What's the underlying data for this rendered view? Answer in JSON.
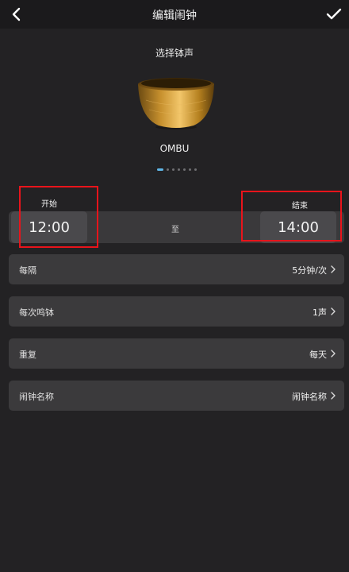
{
  "header": {
    "title": "编辑闹钟",
    "back_icon": "chevron-left-icon",
    "confirm_icon": "checkmark-icon"
  },
  "sound_picker": {
    "title": "选择钵声",
    "selected_name": "OMBU",
    "page_count": 7,
    "active_page": 1
  },
  "time_range": {
    "start_label": "开始",
    "start_time": "12:00",
    "separator": "至",
    "end_label": "结束",
    "end_time": "14:00"
  },
  "settings": [
    {
      "label": "每隔",
      "value": "5分钟/次"
    },
    {
      "label": "每次鸣钵",
      "value": "1声"
    },
    {
      "label": "重复",
      "value": "每天"
    },
    {
      "label": "闹钟名称",
      "value": "闹钟名称"
    }
  ],
  "colors": {
    "background": "#232224",
    "row_background": "#3b3a3c",
    "highlight": "#e8141b",
    "active_dot": "#5fb6e6"
  }
}
